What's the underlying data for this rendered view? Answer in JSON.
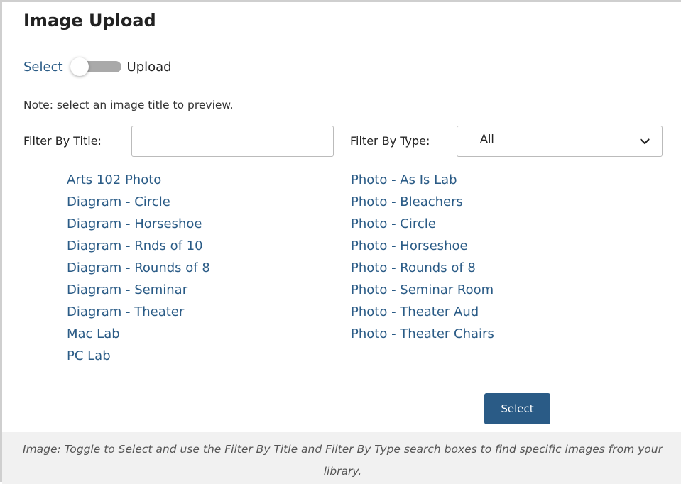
{
  "title": "Image Upload",
  "toggle": {
    "left_label": "Select",
    "right_label": "Upload",
    "state": "Select"
  },
  "note": "Note: select an image title to preview.",
  "filters": {
    "title_label": "Filter By Title:",
    "title_value": "",
    "type_label": "Filter By Type:",
    "type_value": "All"
  },
  "images_left": [
    "Arts 102 Photo",
    "Diagram - Circle",
    "Diagram - Horseshoe",
    "Diagram - Rnds of 10",
    "Diagram - Rounds of 8",
    "Diagram - Seminar",
    "Diagram - Theater",
    "Mac Lab",
    "PC Lab"
  ],
  "images_right": [
    "Photo - As Is Lab",
    "Photo - Bleachers",
    "Photo - Circle",
    "Photo - Horseshoe",
    "Photo - Rounds of 8",
    "Photo - Seminar Room",
    "Photo - Theater Aud",
    "Photo - Theater Chairs"
  ],
  "select_button": "Select",
  "caption": "Image: Toggle to Select and use the Filter By Title and Filter By Type search boxes to find specific images from your library.",
  "colors": {
    "link": "#2a5b86",
    "button_bg": "#2a5b86",
    "caption_bg": "#f1f1f1"
  },
  "icons": {
    "select_chevron": "chevron-down-icon"
  }
}
